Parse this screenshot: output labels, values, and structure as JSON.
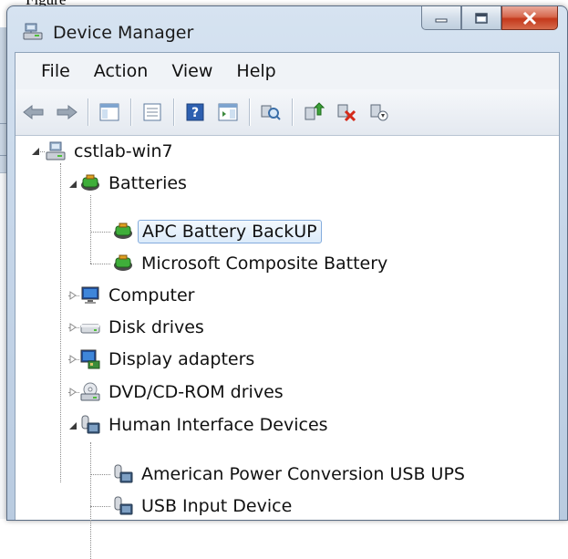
{
  "background": {
    "top_text": "Figure"
  },
  "window": {
    "title": "Device Manager"
  },
  "menu": {
    "items": [
      "File",
      "Action",
      "View",
      "Help"
    ]
  },
  "tree": {
    "root": "cstlab-win7",
    "nodes": [
      {
        "label": "Batteries",
        "icon": "battery-icon",
        "expanded": true
      },
      {
        "label": "APC Battery BackUP",
        "icon": "battery-icon",
        "selected": true
      },
      {
        "label": "Microsoft Composite Battery",
        "icon": "battery-icon"
      },
      {
        "label": "Computer",
        "icon": "computer-icon",
        "expanded": false
      },
      {
        "label": "Disk drives",
        "icon": "disk-drive-icon",
        "expanded": false
      },
      {
        "label": "Display adapters",
        "icon": "display-adapter-icon",
        "expanded": false
      },
      {
        "label": "DVD/CD-ROM drives",
        "icon": "dvd-drive-icon",
        "expanded": false
      },
      {
        "label": "Human Interface Devices",
        "icon": "hid-icon",
        "expanded": true
      },
      {
        "label": "American Power Conversion USB UPS",
        "icon": "hid-icon"
      },
      {
        "label": "USB Input Device",
        "icon": "hid-icon"
      }
    ]
  },
  "colors": {
    "title_bar": "#c6d6e9",
    "close_button": "#c4381b",
    "selection_border": "#84acdd"
  }
}
